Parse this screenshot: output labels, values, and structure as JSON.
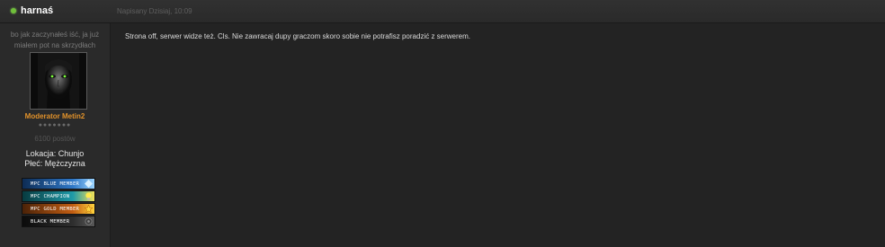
{
  "post": {
    "username": "harnaś",
    "date": "Napisany Dzisiaj, 10:09",
    "message": "Strona off, serwer widze też. Cls. Nie zawracaj dupy graczom skoro sobie nie potrafisz poradzić z serwerem."
  },
  "author": {
    "title_line1": "bo jak zaczynałeś iść, ja już",
    "title_line2": "miałem pot na skrzydłach",
    "rank": "Moderator Metin2",
    "rank_stars": "●●●●●●●",
    "posts": "6100 postów",
    "location": "Lokacja: Chunjo",
    "gender": "Płeć: Mężczyzna"
  },
  "badges": [
    {
      "label": "MPC BLUE MEMBER",
      "icon": "blue-member-icon"
    },
    {
      "label": "MPC CHAMPION",
      "icon": "lightbulb-icon"
    },
    {
      "label": "MPC GOLD MEMBER",
      "icon": "gold-star-icon"
    },
    {
      "label": "BLACK MEMBER",
      "icon": "black-emblem-icon"
    }
  ],
  "colors": {
    "status_online": "#6fbf3a",
    "rank_color": "#e0912a"
  }
}
